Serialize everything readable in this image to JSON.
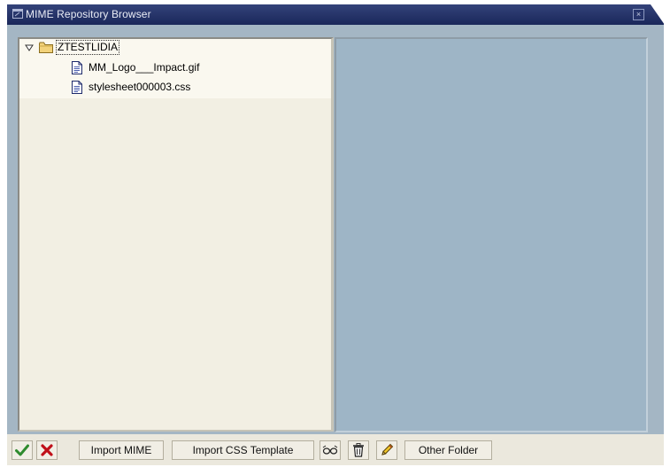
{
  "window": {
    "title": "MIME Repository Browser",
    "title_icon": "window-icon",
    "close_icon": "close-icon"
  },
  "tree": {
    "root": {
      "label": "ZTESTLIDIA",
      "expanded": true,
      "icon": "folder-icon"
    },
    "files": [
      {
        "label": "MM_Logo___Impact.gif",
        "icon": "document-icon"
      },
      {
        "label": "stylesheet000003.css",
        "icon": "document-icon"
      }
    ]
  },
  "toolbar": {
    "confirm_icon": "checkmark-icon",
    "cancel_icon": "cancel-x-icon",
    "import_mime": "Import MIME",
    "import_css_template": "Import CSS Template",
    "display_icon": "glasses-icon",
    "delete_icon": "trash-icon",
    "edit_icon": "pencil-icon",
    "other_folder": "Other Folder"
  },
  "colors": {
    "titlebar": "#1f2c60",
    "window_bg": "#a4b6c4",
    "tree_bg": "#f2efe3",
    "content_bg": "#9eb5c6",
    "toolbar_bg": "#ebe8dd",
    "confirm_green": "#2e8b2e",
    "cancel_red": "#c0101a"
  }
}
